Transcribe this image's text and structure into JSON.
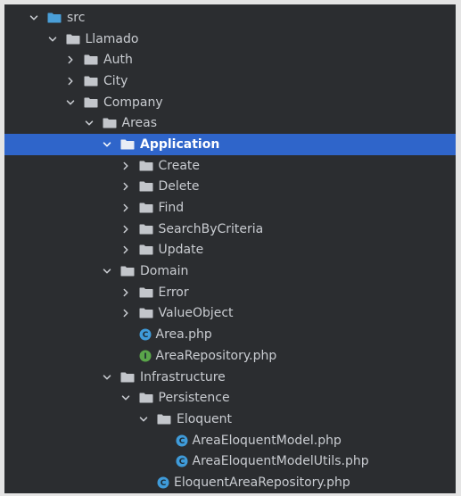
{
  "tree": {
    "items": [
      {
        "label": "src",
        "depth": 0,
        "kind": "folder",
        "expanded": true,
        "icon": "source-folder-icon",
        "selected": false
      },
      {
        "label": "Llamado",
        "depth": 1,
        "kind": "folder",
        "expanded": true,
        "icon": "folder-icon",
        "selected": false
      },
      {
        "label": "Auth",
        "depth": 2,
        "kind": "folder",
        "expanded": false,
        "icon": "folder-icon",
        "selected": false
      },
      {
        "label": "City",
        "depth": 2,
        "kind": "folder",
        "expanded": false,
        "icon": "folder-icon",
        "selected": false
      },
      {
        "label": "Company",
        "depth": 2,
        "kind": "folder",
        "expanded": true,
        "icon": "folder-icon",
        "selected": false
      },
      {
        "label": "Areas",
        "depth": 3,
        "kind": "folder",
        "expanded": true,
        "icon": "folder-icon",
        "selected": false
      },
      {
        "label": "Application",
        "depth": 4,
        "kind": "folder",
        "expanded": true,
        "icon": "folder-icon",
        "selected": true
      },
      {
        "label": "Create",
        "depth": 5,
        "kind": "folder",
        "expanded": false,
        "icon": "folder-icon",
        "selected": false
      },
      {
        "label": "Delete",
        "depth": 5,
        "kind": "folder",
        "expanded": false,
        "icon": "folder-icon",
        "selected": false
      },
      {
        "label": "Find",
        "depth": 5,
        "kind": "folder",
        "expanded": false,
        "icon": "folder-icon",
        "selected": false
      },
      {
        "label": "SearchByCriteria",
        "depth": 5,
        "kind": "folder",
        "expanded": false,
        "icon": "folder-icon",
        "selected": false
      },
      {
        "label": "Update",
        "depth": 5,
        "kind": "folder",
        "expanded": false,
        "icon": "folder-icon",
        "selected": false
      },
      {
        "label": "Domain",
        "depth": 4,
        "kind": "folder",
        "expanded": true,
        "icon": "folder-icon",
        "selected": false
      },
      {
        "label": "Error",
        "depth": 5,
        "kind": "folder",
        "expanded": false,
        "icon": "folder-icon",
        "selected": false
      },
      {
        "label": "ValueObject",
        "depth": 5,
        "kind": "folder",
        "expanded": false,
        "icon": "folder-icon",
        "selected": false
      },
      {
        "label": "Area.php",
        "depth": 5,
        "kind": "file",
        "icon": "php-class-icon",
        "selected": false
      },
      {
        "label": "AreaRepository.php",
        "depth": 5,
        "kind": "file",
        "icon": "php-interface-icon",
        "selected": false
      },
      {
        "label": "Infrastructure",
        "depth": 4,
        "kind": "folder",
        "expanded": true,
        "icon": "folder-icon",
        "selected": false
      },
      {
        "label": "Persistence",
        "depth": 5,
        "kind": "folder",
        "expanded": true,
        "icon": "folder-icon",
        "selected": false
      },
      {
        "label": "Eloquent",
        "depth": 6,
        "kind": "folder",
        "expanded": true,
        "icon": "folder-icon",
        "selected": false
      },
      {
        "label": "AreaEloquentModel.php",
        "depth": 7,
        "kind": "file",
        "icon": "php-class-icon",
        "selected": false
      },
      {
        "label": "AreaEloquentModelUtils.php",
        "depth": 7,
        "kind": "file",
        "icon": "php-class-icon",
        "selected": false
      },
      {
        "label": "EloquentAreaRepository.php",
        "depth": 6,
        "kind": "file",
        "icon": "php-class-icon",
        "selected": false
      }
    ]
  },
  "colors": {
    "panel_background": "#2b2d30",
    "selection": "#2f65ca",
    "text": "#c9ccd1",
    "folder": "#c3c6cb",
    "source_folder": "#4a9fd8",
    "class_icon": "#3f9bd9",
    "interface_icon": "#5aa54a",
    "chevron": "#c9ccd1"
  }
}
